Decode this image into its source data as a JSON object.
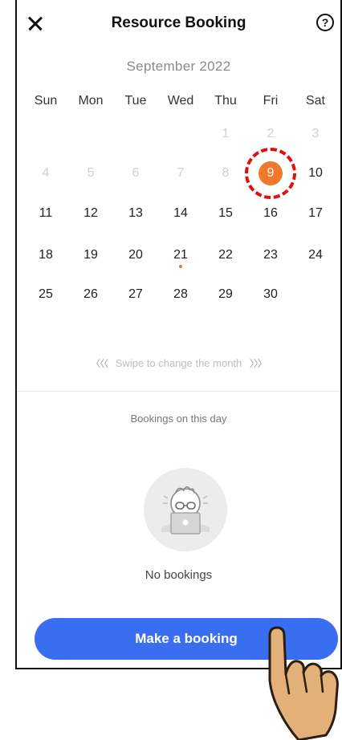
{
  "header": {
    "title": "Resource Booking",
    "close_icon": "close-icon",
    "help_icon": "help-icon",
    "help_glyph": "?"
  },
  "calendar": {
    "month_label": "September 2022",
    "weekdays": [
      "Sun",
      "Mon",
      "Tue",
      "Wed",
      "Thu",
      "Fri",
      "Sat"
    ],
    "weeks": [
      [
        "",
        "",
        "",
        "",
        "1",
        "2",
        "3"
      ],
      [
        "4",
        "5",
        "6",
        "7",
        "8",
        "9",
        "10"
      ],
      [
        "11",
        "12",
        "13",
        "14",
        "15",
        "16",
        "17"
      ],
      [
        "18",
        "19",
        "20",
        "21",
        "22",
        "23",
        "24"
      ],
      [
        "25",
        "26",
        "27",
        "28",
        "29",
        "30",
        ""
      ]
    ],
    "selected_day": "9",
    "marked_day": "21",
    "swipe_hint": "Swipe to change the month",
    "swipe_left_glyph": "〈〈〈",
    "swipe_right_glyph": "〉〉〉"
  },
  "bookings": {
    "section_label": "Bookings on this day",
    "empty_text": "No bookings",
    "empty_illustration": "person-with-laptop-illustration"
  },
  "cta": {
    "label": "Make a booking"
  },
  "colors": {
    "accent_orange": "#f0782a",
    "primary_blue": "#3a6ef0",
    "annotation_red": "#e01010",
    "muted_day": "#cfcfcf"
  }
}
